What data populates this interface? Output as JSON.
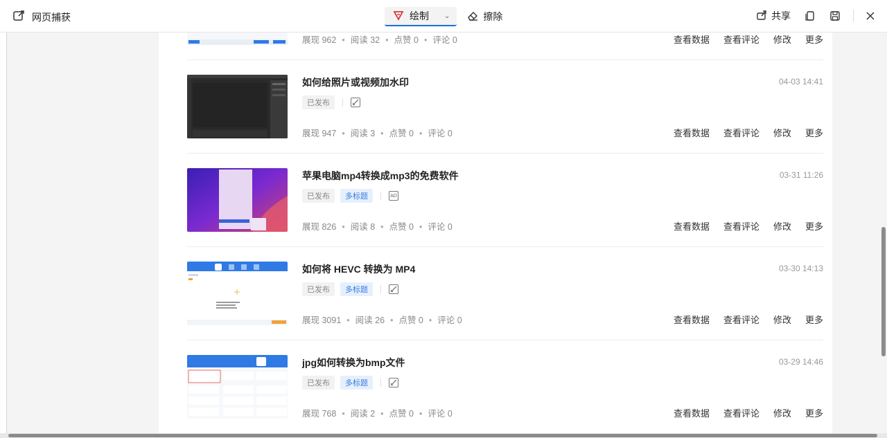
{
  "toolbar": {
    "app_title": "网页捕获",
    "draw_label": "绘制",
    "erase_label": "擦除",
    "share_label": "共享"
  },
  "articles": [
    {
      "title": "",
      "date": "",
      "tags": [],
      "stats": {
        "views": "展现 962",
        "reads": "阅读 32",
        "likes": "点赞 0",
        "comments": "评论 0"
      },
      "actions": [
        "查看数据",
        "查看评论",
        "修改",
        "更多"
      ]
    },
    {
      "title": "如何给照片或视频加水印",
      "date": "04-03 14:41",
      "tags": [
        "已发布"
      ],
      "stats": {
        "views": "展现 947",
        "reads": "阅读 3",
        "likes": "点赞 0",
        "comments": "评论 0"
      },
      "actions": [
        "查看数据",
        "查看评论",
        "修改",
        "更多"
      ]
    },
    {
      "title": "苹果电脑mp4转换成mp3的免费软件",
      "date": "03-31 11:26",
      "tags": [
        "已发布",
        "多标题"
      ],
      "badge": "AD",
      "stats": {
        "views": "展现 826",
        "reads": "阅读 8",
        "likes": "点赞 0",
        "comments": "评论 0"
      },
      "actions": [
        "查看数据",
        "查看评论",
        "修改",
        "更多"
      ]
    },
    {
      "title": "如何将 HEVC 转换为 MP4",
      "date": "03-30 14:13",
      "tags": [
        "已发布",
        "多标题"
      ],
      "stats": {
        "views": "展现 3091",
        "reads": "阅读 26",
        "likes": "点赞 0",
        "comments": "评论 0"
      },
      "actions": [
        "查看数据",
        "查看评论",
        "修改",
        "更多"
      ]
    },
    {
      "title": "jpg如何转换为bmp文件",
      "date": "03-29 14:46",
      "tags": [
        "已发布",
        "多标题"
      ],
      "stats": {
        "views": "展现 768",
        "reads": "阅读 2",
        "likes": "点赞 0",
        "comments": "评论 0"
      },
      "actions": [
        "查看数据",
        "查看评论",
        "修改",
        "更多"
      ]
    }
  ],
  "colors": {
    "accent": "#1a6fd6",
    "tag_blue_bg": "#e6f0fd",
    "tag_blue_text": "#3a7be0",
    "draw_icon": "#d9363e"
  }
}
